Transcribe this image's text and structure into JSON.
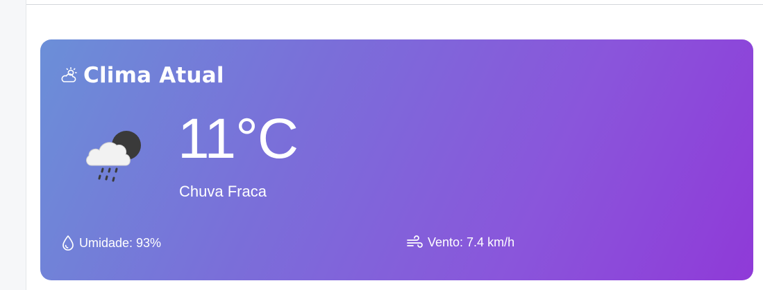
{
  "card": {
    "title": "Clima Atual",
    "header_icon": "sun-cloud-icon",
    "temperature": "11°C",
    "condition": "Chuva Fraca",
    "condition_icon": "rain-cloud-night-icon",
    "humidity": {
      "icon": "water-drop-icon",
      "label": "Umidade: 93%"
    },
    "wind": {
      "icon": "wind-icon",
      "label": "Vento: 7.4 km/h"
    }
  },
  "colors": {
    "gradient_start": "#6b8fd8",
    "gradient_end": "#8f3ad8",
    "text": "#ffffff"
  }
}
